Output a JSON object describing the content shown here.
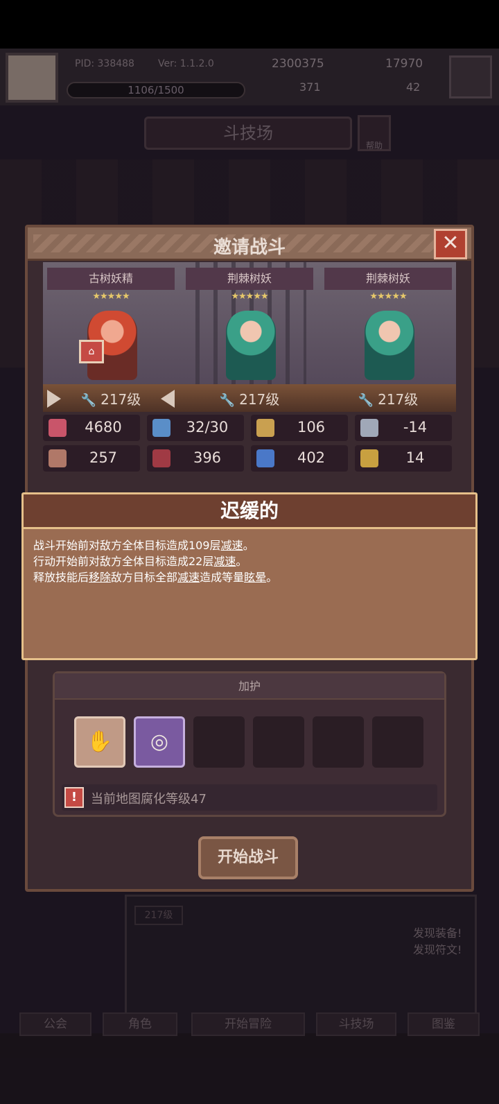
{
  "topbar": {
    "pid": "PID: 338488",
    "version": "Ver: 1.1.2.0",
    "coins": "2300375",
    "gems": "17970",
    "shards": "371",
    "keys": "42",
    "xp": "1106/1500"
  },
  "arena": {
    "title": "斗技场",
    "help": "帮助"
  },
  "dialog": {
    "title": "邀请战斗",
    "close_label": "✕",
    "heroes": [
      {
        "name": "古树妖精",
        "stars": "★★★★★",
        "level": "217级",
        "color": "red"
      },
      {
        "name": "荆棘树妖",
        "stars": "★★★★★",
        "level": "217级",
        "color": "green"
      },
      {
        "name": "荆棘树妖",
        "stars": "★★★★★",
        "level": "217级",
        "color": "green"
      }
    ],
    "stats": [
      {
        "icon": "heart-icon",
        "value": "4680",
        "color": "#c9556a"
      },
      {
        "icon": "mana-drop-icon",
        "value": "32/30",
        "color": "#5a8ec8"
      },
      {
        "icon": "shield-icon",
        "value": "106",
        "color": "#c9a050"
      },
      {
        "icon": "wing-icon",
        "value": "-14",
        "color": "#a0a8b8"
      },
      {
        "icon": "scroll-icon",
        "value": "257",
        "color": "#b07868"
      },
      {
        "icon": "book-icon",
        "value": "396",
        "color": "#a03a44"
      },
      {
        "icon": "boot-icon",
        "value": "402",
        "color": "#4a78c8"
      },
      {
        "icon": "horseshoe-icon",
        "value": "14",
        "color": "#c8a040"
      }
    ],
    "protect": {
      "header": "加护",
      "corruption_prefix": "当前地图",
      "corruption_word": "腐化",
      "corruption_suffix": "等级47"
    },
    "start_label": "开始战斗"
  },
  "tooltip": {
    "title": "迟缓的",
    "line1_a": "战斗开始前对敌方全体目标造成109层",
    "line1_u": "减速",
    "line1_b": "。",
    "line2_a": "行动开始前对敌方全体目标造成22层",
    "line2_u": "减速",
    "line2_b": "。",
    "line3_a": "释放技能后",
    "line3_u1": "移除",
    "line3_b": "敌方目标全部",
    "line3_u2": "减速",
    "line3_c": "造成等量",
    "line3_u3": "眩晕",
    "line3_d": "。"
  },
  "background": {
    "found_gear": "发现装备!",
    "found_rune": "发现符文!",
    "level_pill": "217级"
  },
  "nav": {
    "guild": "公会",
    "character": "角色",
    "adventure": "开始冒险",
    "arena": "斗技场",
    "codex": "图鉴"
  }
}
